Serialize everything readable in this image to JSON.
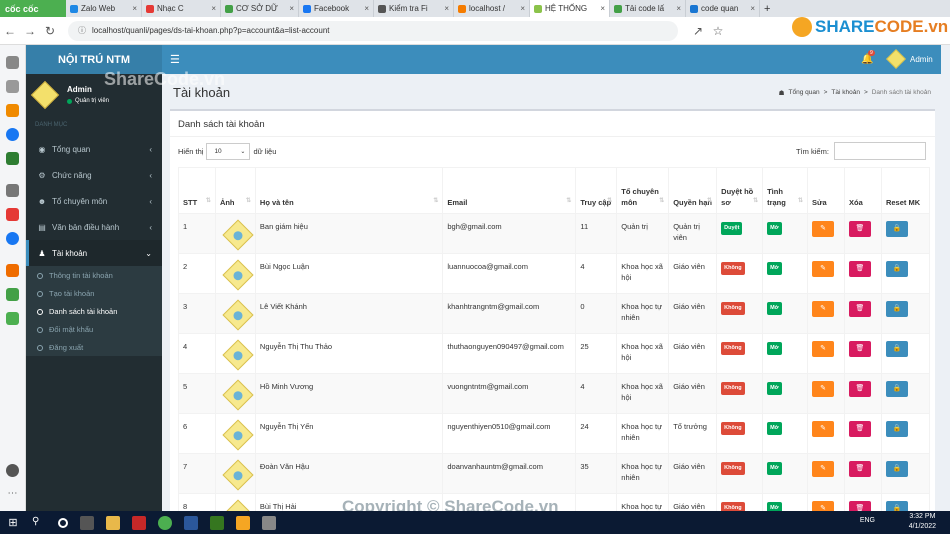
{
  "browser": {
    "brand": "cốc cốc",
    "tabs": [
      {
        "label": "Zalo Web",
        "color": "#1e88e5"
      },
      {
        "label": "Nhạc C",
        "color": "#e53935"
      },
      {
        "label": "CƠ SỞ DỮ",
        "color": "#43a047"
      },
      {
        "label": "Facebook",
        "color": "#1877f2"
      },
      {
        "label": "Kiểm tra Fi",
        "color": "#555555"
      },
      {
        "label": "localhost /",
        "color": "#f57c00"
      },
      {
        "label": "HỆ THỐNG",
        "color": "#8bc34a"
      },
      {
        "label": "Tải code lấ",
        "color": "#43a047"
      },
      {
        "label": "code quan",
        "color": "#1976d2"
      }
    ],
    "new_tab": "+",
    "url": "localhost/quanli/pages/ds-tai-khoan.php?p=account&a=list-account"
  },
  "sharecode_logo": {
    "first": "SHARE",
    "second": "CODE.vn"
  },
  "header": {
    "logo": "NỘI TRÚ NTM",
    "notif_count": "9",
    "user": "Admin"
  },
  "sidebar": {
    "user_name": "Admin",
    "user_role": "Quản trị viên",
    "section": "DANH MỤC",
    "items": [
      {
        "label": "Tổng quan",
        "icon": "dashboard-icon"
      },
      {
        "label": "Chức năng",
        "icon": "gear-icon"
      },
      {
        "label": "Tổ chuyên môn",
        "icon": "group-icon"
      },
      {
        "label": "Văn bản điều hành",
        "icon": "file-icon"
      },
      {
        "label": "Tài khoản",
        "icon": "user-icon"
      }
    ],
    "sub_items": [
      "Thông tin tài khoản",
      "Tạo tài khoản",
      "Danh sách tài khoản",
      "Đổi mật khẩu",
      "Đăng xuất"
    ]
  },
  "page": {
    "title": "Tài khoản",
    "breadcrumb": [
      "Tổng quan",
      "Tài khoản",
      "Danh sách tài khoản"
    ],
    "box_title": "Danh sách tài khoản",
    "length_prefix": "Hiển thị",
    "length_value": "10",
    "length_suffix": "dữ liệu",
    "search_label": "Tìm kiếm:"
  },
  "table": {
    "columns": [
      "STT",
      "Ảnh",
      "Họ và tên",
      "Email",
      "Truy cập",
      "Tổ chuyên môn",
      "Quyền hạn",
      "Duyệt hồ sơ",
      "Tình trạng",
      "Sửa",
      "Xóa",
      "Reset MK"
    ],
    "rows": [
      {
        "stt": "1",
        "name": "Ban giám hiệu",
        "email": "bgh@gmail.com",
        "visits": "11",
        "group": "Quản trị",
        "role": "Quản trị viên",
        "approved": "Duyệt",
        "status": "Mở"
      },
      {
        "stt": "2",
        "name": "Bùi Ngọc Luận",
        "email": "luannuocoa@gmail.com",
        "visits": "4",
        "group": "Khoa học xã hội",
        "role": "Giáo viên",
        "approved": "Không",
        "status": "Mở"
      },
      {
        "stt": "3",
        "name": "Lê Viết Khánh",
        "email": "khanhtrangntm@gmail.com",
        "visits": "0",
        "group": "Khoa học tự nhiên",
        "role": "Giáo viên",
        "approved": "Không",
        "status": "Mở"
      },
      {
        "stt": "4",
        "name": "Nguyễn Thị Thu Thảo",
        "email": "thuthaonguyen090497@gmail.com",
        "visits": "25",
        "group": "Khoa học xã hội",
        "role": "Giáo viên",
        "approved": "Không",
        "status": "Mở"
      },
      {
        "stt": "5",
        "name": "Hồ Minh Vương",
        "email": "vuongntntm@gmail.com",
        "visits": "4",
        "group": "Khoa học xã hội",
        "role": "Giáo viên",
        "approved": "Không",
        "status": "Mở"
      },
      {
        "stt": "6",
        "name": "Nguyễn Thị Yến",
        "email": "nguyenthiyen0510@gmail.com",
        "visits": "24",
        "group": "Khoa học tự nhiên",
        "role": "Tổ trưởng",
        "approved": "Không",
        "status": "Mở"
      },
      {
        "stt": "7",
        "name": "Đoàn Văn Hậu",
        "email": "doanvanhauntm@gmail.com",
        "visits": "35",
        "group": "Khoa học tự nhiên",
        "role": "Giáo viên",
        "approved": "Không",
        "status": "Mở"
      },
      {
        "stt": "8",
        "name": "Bùi Thị Hải",
        "email": "",
        "visits": "",
        "group": "Khoa học tự",
        "role": "Giáo viên",
        "approved": "Không",
        "status": "Mở"
      }
    ]
  },
  "taskbar": {
    "lang": "ENG",
    "time": "3:32 PM",
    "date": "4/1/2022"
  },
  "watermarks": {
    "bottom": "Copyright © ShareCode.vn",
    "top": "ShareCode.vn"
  },
  "colors": {
    "header": "#3c8dbc",
    "sidebar": "#222d32",
    "approved": "#00a65a",
    "rejected": "#dd4b39",
    "edit": "#ff851b",
    "delete": "#d81b60",
    "reset": "#3c8dbc"
  }
}
